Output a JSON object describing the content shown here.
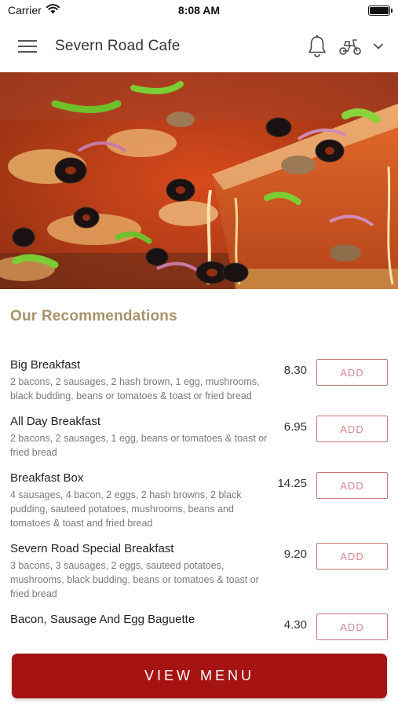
{
  "status_bar": {
    "carrier": "Carrier",
    "time": "8:08 AM"
  },
  "header": {
    "title": "Severn Road Cafe",
    "icons": [
      "menu-icon",
      "bell-icon",
      "scooter-icon",
      "chevron-down-icon"
    ]
  },
  "hero": {
    "image": "pizza-photo"
  },
  "recommendations": {
    "title": "Our Recommendations",
    "add_label": "ADD",
    "items": [
      {
        "name": "Big Breakfast",
        "description": "2 bacons, 2 sausages, 2 hash brown, 1 egg, mushrooms, black budding, beans or tomatoes & toast or fried bread",
        "price": "8.30"
      },
      {
        "name": "All Day Breakfast",
        "description": "2 bacons, 2 sausages, 1 egg, beans or tomatoes & toast or fried bread",
        "price": "6.95"
      },
      {
        "name": "Breakfast Box",
        "description": "4 sausages, 4 bacon, 2 eggs, 2 hash browns, 2 black pudding, sauteed potatoes, mushrooms, beans and tomatoes & toast and fried bread",
        "price": "14.25"
      },
      {
        "name": "Severn Road Special Breakfast",
        "description": "3 bacons, 3 sausages, 2 eggs, sauteed potatoes, mushrooms, black budding, beans or tomatoes & toast or fried bread",
        "price": "9.20"
      },
      {
        "name": "Bacon, Sausage And Egg Baguette",
        "description": "",
        "price": "4.30"
      }
    ]
  },
  "footer": {
    "view_menu_label": "VIEW MENU"
  },
  "colors": {
    "brand": "#a51313",
    "accent_text": "#a8936a",
    "add_border": "#c9777a"
  }
}
